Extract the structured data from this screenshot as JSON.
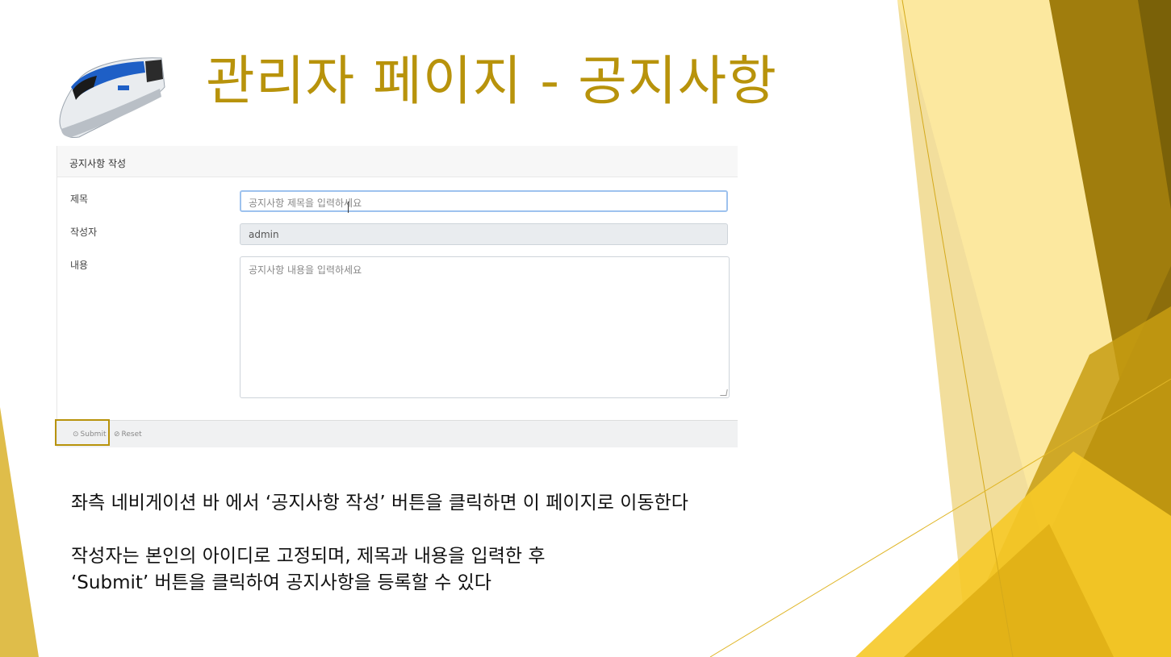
{
  "slide": {
    "title": "관리자 페이지 - 공지사항",
    "accent_color": "#b8930b"
  },
  "logo": {
    "icon": "ktx-train-icon"
  },
  "form": {
    "header": "공지사항 작성",
    "title_label": "제목",
    "title_placeholder": "공지사항 제목을 입력하세요",
    "author_label": "작성자",
    "author_value": "admin",
    "content_label": "내용",
    "content_placeholder": "공지사항 내용을 입력하세요",
    "submit_label": "Submit",
    "reset_label": "Reset",
    "submit_icon": "circle-arrow-icon",
    "reset_icon": "ban-icon"
  },
  "description": {
    "line1": "좌측 네비게이션 바 에서 ‘공지사항 작성’ 버튼을 클릭하면 이 페이지로 이동한다",
    "line2": "작성자는 본인의 아이디로 고정되며, 제목과 내용을 입력한 후",
    "line3": "‘Submit’ 버튼을 클릭하여 공지사항을 등록할 수 있다"
  }
}
